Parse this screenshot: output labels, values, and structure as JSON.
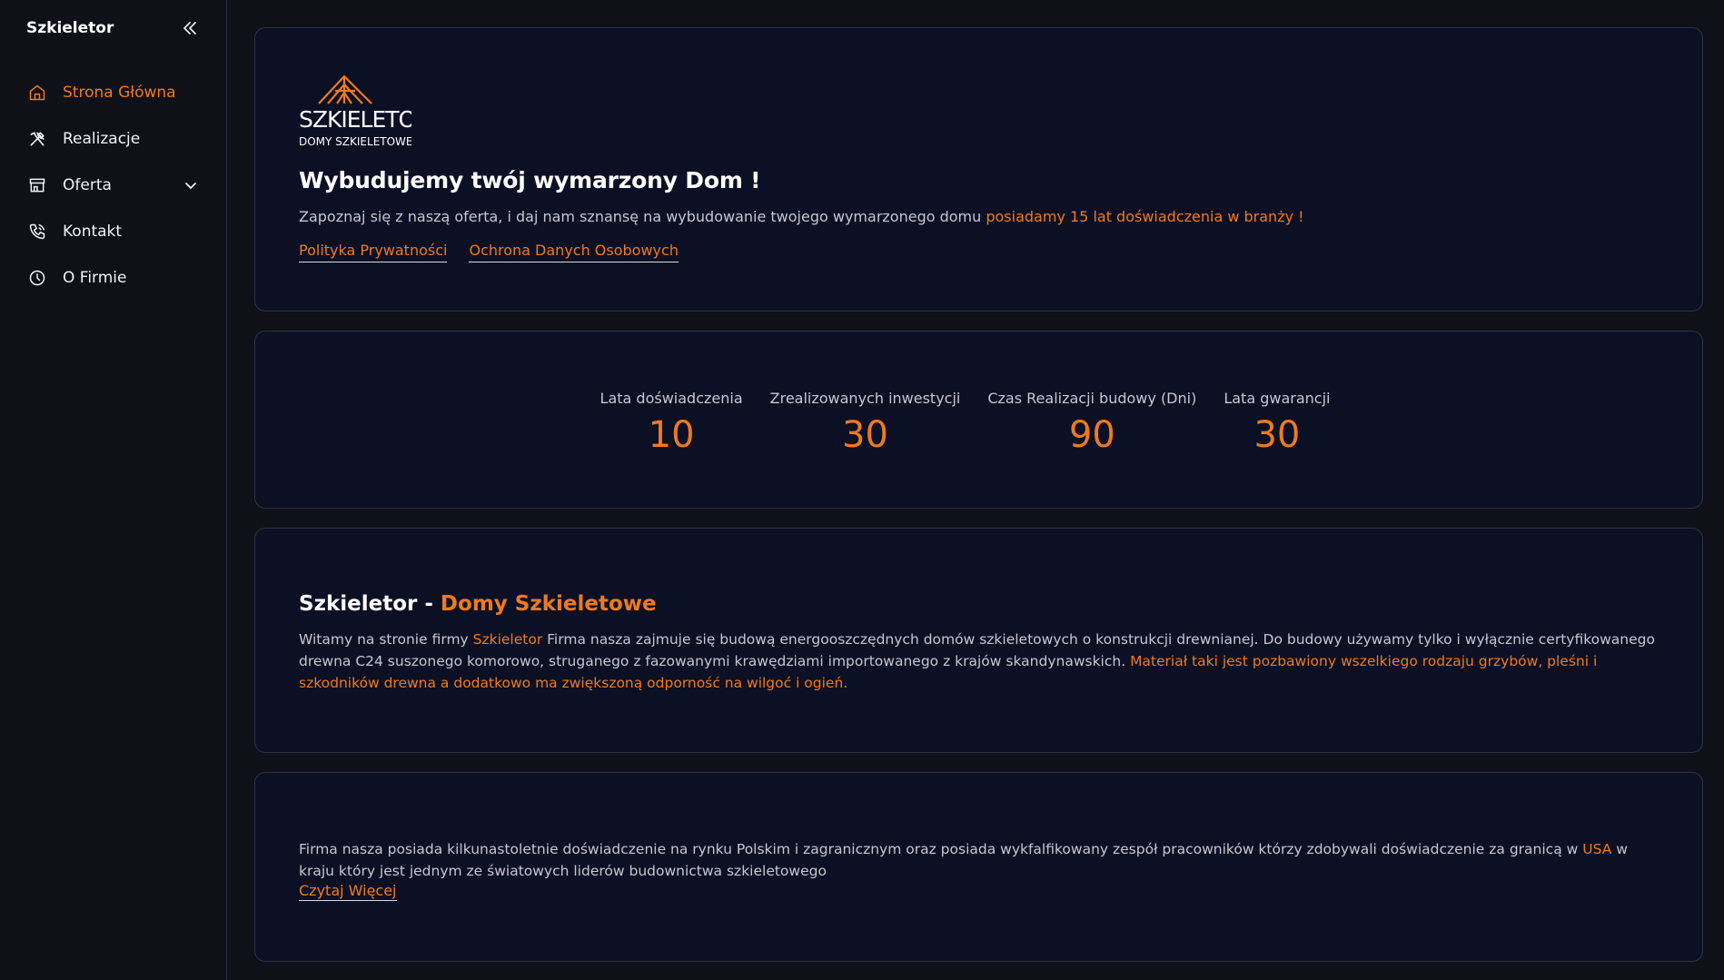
{
  "sidebar": {
    "brand": "Szkieletor",
    "items": [
      {
        "label": "Strona Główna",
        "icon": "home-icon"
      },
      {
        "label": "Realizacje",
        "icon": "tools-icon"
      },
      {
        "label": "Oferta",
        "icon": "store-icon"
      },
      {
        "label": "Kontakt",
        "icon": "phone-icon"
      },
      {
        "label": "O Firmie",
        "icon": "clock-icon"
      }
    ]
  },
  "hero": {
    "logo_text": "SZKIELETOR",
    "logo_subtext": "DOMY SZKIELETOWE",
    "title": "Wybudujemy twój wymarzony Dom !",
    "text": "Zapoznaj się z naszą oferta, i daj nam sznansę na wybudowanie twojego wymarzonego domu ",
    "text_accent": "posiadamy 15 lat doświadczenia w branży !",
    "links": [
      "Polityka Prywatności",
      "Ochrona Danych Osobowych"
    ]
  },
  "stats": [
    {
      "label": "Lata doświadczenia",
      "value": "10"
    },
    {
      "label": "Zrealizowanych inwestycji",
      "value": "30"
    },
    {
      "label": "Czas Realizacji budowy (Dni)",
      "value": "90"
    },
    {
      "label": "Lata gwarancji",
      "value": "30"
    }
  ],
  "about": {
    "title": "Szkieletor - ",
    "title_accent": "Domy Szkieletowe",
    "text_1": "Witamy na stronie firmy ",
    "text_brand": "Szkieletor",
    "text_2": " Firma nasza zajmuje się budową energooszczędnych domów szkieletowych o konstrukcji drewnianej. Do budowy używamy tylko i wyłącznie certyfikowanego drewna C24 suszonego komorowo, struganego z fazowanymi krawędziami importowanego z krajów skandynawskich. ",
    "text_accent": "Materiał taki jest pozbawiony wszelkiego rodzaju grzybów, pleśni i szkodników drewna a dodatkowo ma zwiększoną odporność na wilgoć i ogień."
  },
  "experience": {
    "text_1": "Firma nasza posiada kilkunastoletnie doświadczenie na rynku Polskim i zagranicznym oraz posiada wykfalfikowany zespół pracowników którzy zdobywali doświadczenie za granicą w ",
    "text_accent": "USA",
    "text_2": " w kraju który jest jednym ze światowych liderów budownictwa szkieletowego",
    "read_more": "Czytaj Więcej"
  },
  "colors": {
    "accent": "#f07a1b",
    "card_bg": "#0b1024",
    "page_bg": "#0f1018"
  }
}
